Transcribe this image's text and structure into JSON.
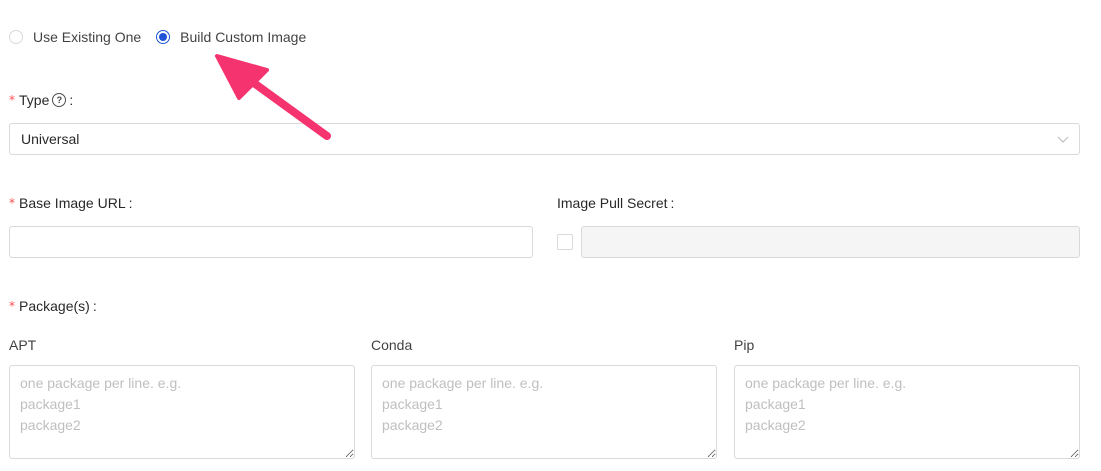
{
  "image_source": {
    "options": [
      {
        "label": "Use Existing One",
        "checked": false
      },
      {
        "label": "Build Custom Image",
        "checked": true
      }
    ]
  },
  "type_field": {
    "label": "Type",
    "help_icon": "question-circle-icon",
    "colon": ":",
    "value": "Universal"
  },
  "base_image": {
    "label": "Base Image URL",
    "colon": ":",
    "value": ""
  },
  "pull_secret": {
    "label": "Image Pull Secret",
    "colon": ":",
    "value": "",
    "checked": false
  },
  "packages": {
    "label": "Package(s)",
    "colon": ":",
    "apt": {
      "label": "APT",
      "placeholder": "one package per line. e.g.\npackage1\npackage2"
    },
    "conda": {
      "label": "Conda",
      "placeholder": "one package per line. e.g.\npackage1\npackage2"
    },
    "pip": {
      "label": "Pip",
      "placeholder": "one package per line. e.g.\npackage1\npackage2"
    }
  },
  "required_mark": "*",
  "colors": {
    "accent": "#1f54d6",
    "required": "#ff4d4f",
    "annotation_arrow": "#f5336f"
  }
}
